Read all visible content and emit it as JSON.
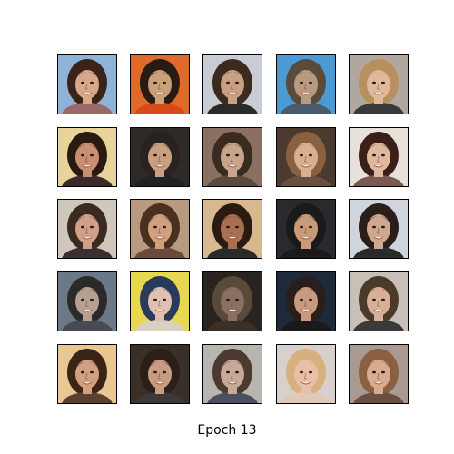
{
  "caption": "Epoch 13",
  "grid": {
    "rows": 5,
    "cols": 5
  },
  "tiles": [
    {
      "bg": "#8fb3d8",
      "hair": "#3a2418",
      "skin": "#d8a88a",
      "shirt": "#9a6a6a"
    },
    {
      "bg": "#e06a2a",
      "hair": "#2a1a14",
      "skin": "#c9a07a",
      "shirt": "#d84a1a"
    },
    {
      "bg": "#c8ccd4",
      "hair": "#3c2a1e",
      "skin": "#caa084",
      "shirt": "#2a2a2a"
    },
    {
      "bg": "#4a9ad6",
      "hair": "#5a4a3a",
      "skin": "#b89a80",
      "shirt": "#4a5a6a"
    },
    {
      "bg": "#b0a89e",
      "hair": "#b89060",
      "skin": "#e0b89a",
      "shirt": "#3a3a3a"
    },
    {
      "bg": "#e8d49a",
      "hair": "#2a1a12",
      "skin": "#c89070",
      "shirt": "#3a2a2a"
    },
    {
      "bg": "#2e2a28",
      "hair": "#2a2220",
      "skin": "#c8a080",
      "shirt": "#222222"
    },
    {
      "bg": "#8a7060",
      "hair": "#3a2a20",
      "skin": "#c8a48c",
      "shirt": "#5a4a40"
    },
    {
      "bg": "#4a3a30",
      "hair": "#8a6040",
      "skin": "#d8b090",
      "shirt": "#6a5040"
    },
    {
      "bg": "#e8e0da",
      "hair": "#3a2018",
      "skin": "#e0b8a0",
      "shirt": "#7a5a50"
    },
    {
      "bg": "#cfc6bc",
      "hair": "#3a2a20",
      "skin": "#d0a088",
      "shirt": "#3a3030"
    },
    {
      "bg": "#b89a80",
      "hair": "#4a3020",
      "skin": "#d0a080",
      "shirt": "#6a4a3a"
    },
    {
      "bg": "#d8b890",
      "hair": "#2a1a10",
      "skin": "#a87050",
      "shirt": "#2a2a2a"
    },
    {
      "bg": "#2a2a2e",
      "hair": "#1a1a1a",
      "skin": "#c89a78",
      "shirt": "#1a1a1a"
    },
    {
      "bg": "#d0d4dc",
      "hair": "#2a1e1a",
      "skin": "#d0a890",
      "shirt": "#2a2a2a"
    },
    {
      "bg": "#6a7888",
      "hair": "#2a2a2a",
      "skin": "#b8a090",
      "shirt": "#4a4a50"
    },
    {
      "bg": "#e8d850",
      "hair": "#2a3a5a",
      "skin": "#e0c0b0",
      "shirt": "#d8d0c0"
    },
    {
      "bg": "#2a2420",
      "hair": "#5a4a3a",
      "skin": "#8a7060",
      "shirt": "#3a3028"
    },
    {
      "bg": "#1e2a3a",
      "hair": "#2a1e1a",
      "skin": "#c89a80",
      "shirt": "#1a1a1a"
    },
    {
      "bg": "#c8c0b8",
      "hair": "#4a3a2a",
      "skin": "#d8b098",
      "shirt": "#3a3a3a"
    },
    {
      "bg": "#e8c890",
      "hair": "#3a2418",
      "skin": "#d0a080",
      "shirt": "#5a4030"
    },
    {
      "bg": "#3a3028",
      "hair": "#2a2018",
      "skin": "#c89c80",
      "shirt": "#3a3a3a"
    },
    {
      "bg": "#b8b4b0",
      "hair": "#4a3a30",
      "skin": "#c8a898",
      "shirt": "#4a5060"
    },
    {
      "bg": "#d8d0cc",
      "hair": "#d8b080",
      "skin": "#e8c0a8",
      "shirt": "#e0c8b8"
    },
    {
      "bg": "#a89a90",
      "hair": "#8a6040",
      "skin": "#d8ac90",
      "shirt": "#6a5040"
    }
  ]
}
